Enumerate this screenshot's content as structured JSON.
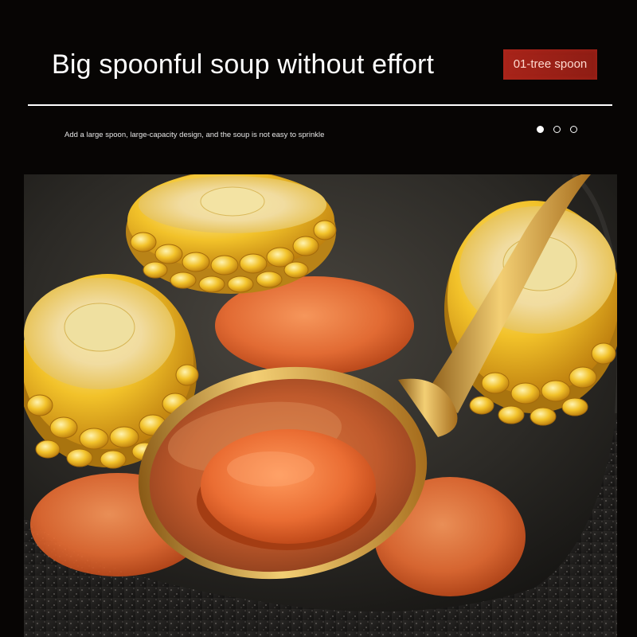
{
  "header": {
    "headline": "Big spoonful soup without effort",
    "tag_label": "01-tree spoon",
    "subtitle": "Add a large spoon, large-capacity design, and the soup is not easy to sprinkle"
  },
  "carousel": {
    "dot_count": 3,
    "active_index": 0
  },
  "photo": {
    "subject": "gold ladle scooping carrot slice from soup with corn cobs in a black pot"
  },
  "colors": {
    "background": "#070504",
    "tag": "#a8241a",
    "gold": "#d9a13c",
    "carrot": "#e8703a"
  }
}
